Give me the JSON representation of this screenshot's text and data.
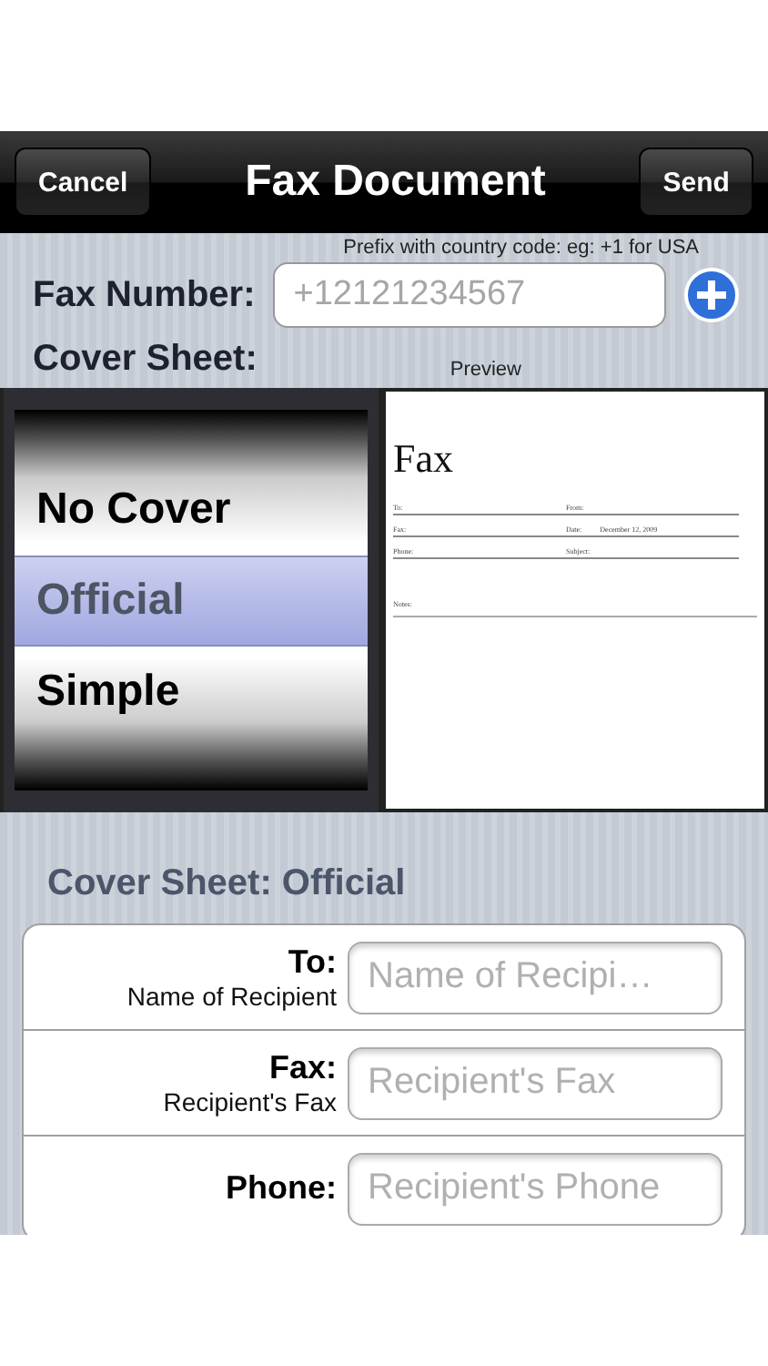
{
  "navbar": {
    "title": "Fax Document",
    "left_button": "Cancel",
    "right_button": "Send"
  },
  "fax_number": {
    "hint": "Prefix with country code: eg: +1 for USA",
    "label": "Fax Number:",
    "placeholder": "+12121234567"
  },
  "cover_sheet": {
    "label": "Cover Sheet:",
    "preview_label": "Preview",
    "options": [
      {
        "label": "No Cover",
        "selected": false
      },
      {
        "label": "Official",
        "selected": true
      },
      {
        "label": "Simple",
        "selected": false
      }
    ]
  },
  "preview": {
    "title": "Fax",
    "fields": [
      {
        "label": "To:"
      },
      {
        "label": "From:"
      },
      {
        "label": "Fax:"
      },
      {
        "label": "Date:",
        "value": "December 12, 2009"
      },
      {
        "label": "Phone:"
      },
      {
        "label": "Subject:"
      }
    ],
    "notes_label": "Notes:"
  },
  "form": {
    "heading": "Cover Sheet: Official",
    "rows": [
      {
        "label": "To:",
        "sublabel": "Name of Recipient",
        "placeholder": "Name of Recipi…"
      },
      {
        "label": "Fax:",
        "sublabel": "Recipient's Fax",
        "placeholder": "Recipient's Fax"
      },
      {
        "label": "Phone:",
        "placeholder": "Recipient's Phone"
      }
    ]
  }
}
